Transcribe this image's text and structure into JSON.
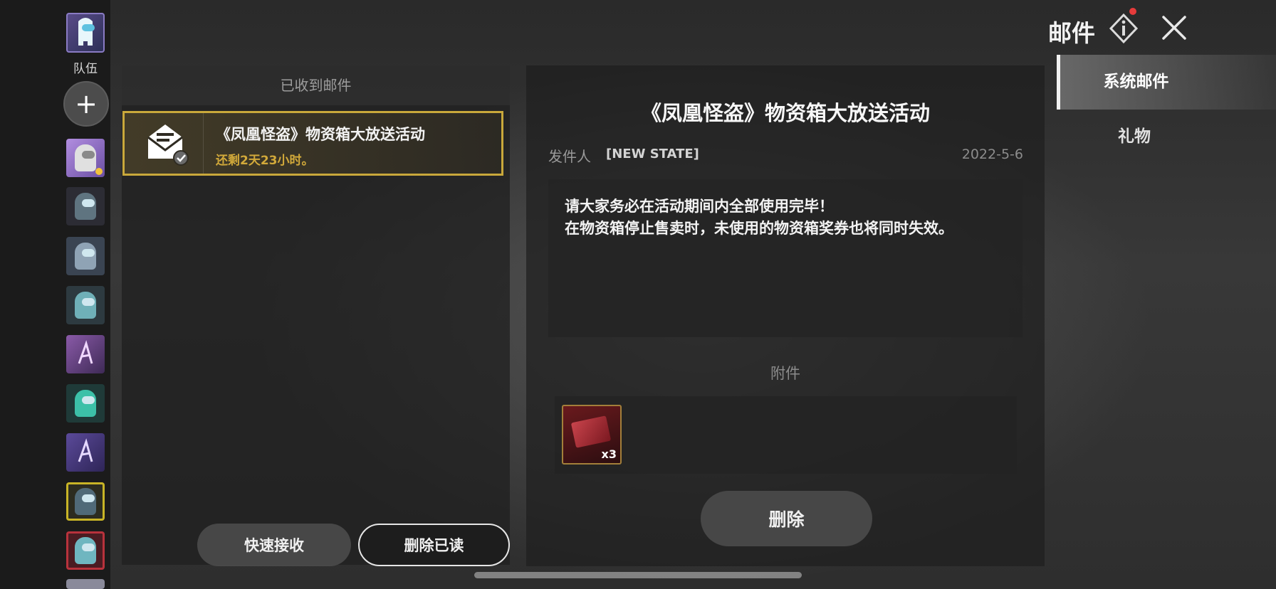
{
  "sidebar": {
    "team_label": "队伍",
    "add_symbol": "+",
    "friend_count": 9
  },
  "mail_list": {
    "header": "已收到邮件",
    "items": [
      {
        "title": "《凤凰怪盗》物资箱大放送活动",
        "remaining": "还剩2天23小时。",
        "icon": "mail-read-icon"
      }
    ],
    "quick_receive_label": "快速接收",
    "delete_read_label": "删除已读"
  },
  "detail": {
    "title": "《凤凰怪盗》物资箱大放送活动",
    "sender_label": "发件人",
    "sender": "[NEW STATE]",
    "date": "2022-5-6",
    "body_lines": [
      "请大家务必在活动期间内全部使用完毕！",
      "在物资箱停止售卖时，未使用的物资箱奖券也将同时失效。"
    ],
    "attachment_label": "附件",
    "attachment_qty": "x3",
    "delete_label": "删除"
  },
  "header": {
    "title": "邮件",
    "info_icon": "info-icon",
    "close_icon": "close-icon"
  },
  "tabs": [
    {
      "label": "系统邮件",
      "active": true
    },
    {
      "label": "礼物",
      "active": false
    }
  ],
  "colors": {
    "accent_gold": "#c9a83b",
    "remaining_text": "#d2a93a",
    "notification_dot": "#e63b3b"
  }
}
